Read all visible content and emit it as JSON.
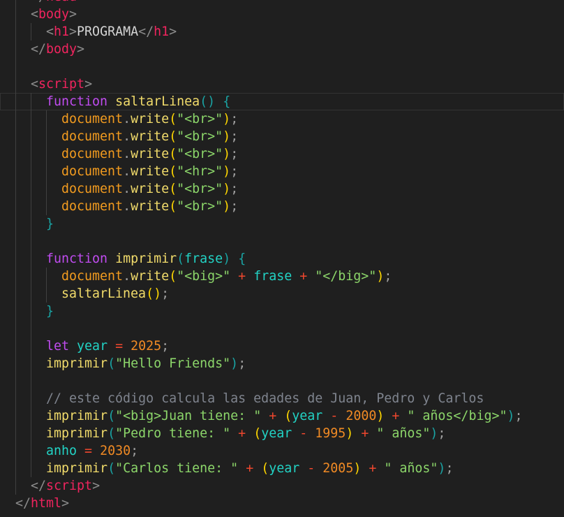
{
  "editor": {
    "current_line": 6,
    "lines": [
      {
        "indent": 1,
        "tokens": [
          [
            "</",
            "b"
          ],
          [
            "head",
            "t"
          ],
          [
            ">",
            "b"
          ]
        ]
      },
      {
        "indent": 1,
        "tokens": [
          [
            "<",
            "b"
          ],
          [
            "body",
            "t"
          ],
          [
            ">",
            "b"
          ]
        ]
      },
      {
        "indent": 2,
        "tokens": [
          [
            "<",
            "b"
          ],
          [
            "h1",
            "t"
          ],
          [
            ">",
            "b"
          ],
          [
            "PROGRAMA",
            "x"
          ],
          [
            "</",
            "b"
          ],
          [
            "h1",
            "t"
          ],
          [
            ">",
            "b"
          ]
        ]
      },
      {
        "indent": 1,
        "tokens": [
          [
            "</",
            "b"
          ],
          [
            "body",
            "t"
          ],
          [
            ">",
            "b"
          ]
        ]
      },
      {
        "indent": 1,
        "tokens": []
      },
      {
        "indent": 1,
        "tokens": [
          [
            "<",
            "b"
          ],
          [
            "script",
            "t"
          ],
          [
            ">",
            "b"
          ]
        ]
      },
      {
        "indent": 2,
        "tokens": [
          [
            "function",
            "k"
          ],
          [
            " ",
            "x"
          ],
          [
            "saltarLinea",
            "f"
          ],
          [
            "()",
            "pt"
          ],
          [
            " ",
            "x"
          ],
          [
            "{",
            "pt"
          ]
        ]
      },
      {
        "indent": 3,
        "tokens": [
          [
            "document",
            "d"
          ],
          [
            ".",
            "p"
          ],
          [
            "write",
            "f"
          ],
          [
            "(",
            "pg"
          ],
          [
            "\"<br>\"",
            "s"
          ],
          [
            ")",
            "pg"
          ],
          [
            ";",
            "p"
          ]
        ]
      },
      {
        "indent": 3,
        "tokens": [
          [
            "document",
            "d"
          ],
          [
            ".",
            "p"
          ],
          [
            "write",
            "f"
          ],
          [
            "(",
            "pg"
          ],
          [
            "\"<br>\"",
            "s"
          ],
          [
            ")",
            "pg"
          ],
          [
            ";",
            "p"
          ]
        ]
      },
      {
        "indent": 3,
        "tokens": [
          [
            "document",
            "d"
          ],
          [
            ".",
            "p"
          ],
          [
            "write",
            "f"
          ],
          [
            "(",
            "pg"
          ],
          [
            "\"<br>\"",
            "s"
          ],
          [
            ")",
            "pg"
          ],
          [
            ";",
            "p"
          ]
        ]
      },
      {
        "indent": 3,
        "tokens": [
          [
            "document",
            "d"
          ],
          [
            ".",
            "p"
          ],
          [
            "write",
            "f"
          ],
          [
            "(",
            "pg"
          ],
          [
            "\"<hr>\"",
            "s"
          ],
          [
            ")",
            "pg"
          ],
          [
            ";",
            "p"
          ]
        ]
      },
      {
        "indent": 3,
        "tokens": [
          [
            "document",
            "d"
          ],
          [
            ".",
            "p"
          ],
          [
            "write",
            "f"
          ],
          [
            "(",
            "pg"
          ],
          [
            "\"<br>\"",
            "s"
          ],
          [
            ")",
            "pg"
          ],
          [
            ";",
            "p"
          ]
        ]
      },
      {
        "indent": 3,
        "tokens": [
          [
            "document",
            "d"
          ],
          [
            ".",
            "p"
          ],
          [
            "write",
            "f"
          ],
          [
            "(",
            "pg"
          ],
          [
            "\"<br>\"",
            "s"
          ],
          [
            ")",
            "pg"
          ],
          [
            ";",
            "p"
          ]
        ]
      },
      {
        "indent": 2,
        "tokens": [
          [
            "}",
            "pt"
          ]
        ]
      },
      {
        "indent": 2,
        "tokens": []
      },
      {
        "indent": 2,
        "tokens": [
          [
            "function",
            "k"
          ],
          [
            " ",
            "x"
          ],
          [
            "imprimir",
            "f"
          ],
          [
            "(",
            "pt"
          ],
          [
            "frase",
            "v"
          ],
          [
            ")",
            "pt"
          ],
          [
            " ",
            "x"
          ],
          [
            "{",
            "pt"
          ]
        ]
      },
      {
        "indent": 3,
        "tokens": [
          [
            "document",
            "d"
          ],
          [
            ".",
            "p"
          ],
          [
            "write",
            "f"
          ],
          [
            "(",
            "pg"
          ],
          [
            "\"<big>\"",
            "s"
          ],
          [
            " + ",
            "o"
          ],
          [
            "frase",
            "v"
          ],
          [
            " + ",
            "o"
          ],
          [
            "\"</big>\"",
            "s"
          ],
          [
            ")",
            "pg"
          ],
          [
            ";",
            "p"
          ]
        ]
      },
      {
        "indent": 3,
        "tokens": [
          [
            "saltarLinea",
            "f"
          ],
          [
            "()",
            "pg"
          ],
          [
            ";",
            "p"
          ]
        ]
      },
      {
        "indent": 2,
        "tokens": [
          [
            "}",
            "pt"
          ]
        ]
      },
      {
        "indent": 2,
        "tokens": []
      },
      {
        "indent": 2,
        "tokens": [
          [
            "let",
            "k"
          ],
          [
            " ",
            "x"
          ],
          [
            "year",
            "v"
          ],
          [
            " = ",
            "o"
          ],
          [
            "2025",
            "n"
          ],
          [
            ";",
            "p"
          ]
        ]
      },
      {
        "indent": 2,
        "tokens": [
          [
            "imprimir",
            "f"
          ],
          [
            "(",
            "pt"
          ],
          [
            "\"Hello Friends\"",
            "s"
          ],
          [
            ")",
            "pt"
          ],
          [
            ";",
            "p"
          ]
        ]
      },
      {
        "indent": 2,
        "tokens": []
      },
      {
        "indent": 2,
        "tokens": [
          [
            "// este código calcula las edades de Juan, Pedro y Carlos",
            "c"
          ]
        ]
      },
      {
        "indent": 2,
        "tokens": [
          [
            "imprimir",
            "f"
          ],
          [
            "(",
            "pt"
          ],
          [
            "\"<big>Juan tiene: \"",
            "s"
          ],
          [
            " + ",
            "o"
          ],
          [
            "(",
            "pg"
          ],
          [
            "year",
            "v"
          ],
          [
            " - ",
            "o"
          ],
          [
            "2000",
            "n"
          ],
          [
            ")",
            "pg"
          ],
          [
            " + ",
            "o"
          ],
          [
            "\" años</big>\"",
            "s"
          ],
          [
            ")",
            "pt"
          ],
          [
            ";",
            "p"
          ]
        ]
      },
      {
        "indent": 2,
        "tokens": [
          [
            "imprimir",
            "f"
          ],
          [
            "(",
            "pt"
          ],
          [
            "\"Pedro tiene: \"",
            "s"
          ],
          [
            " + ",
            "o"
          ],
          [
            "(",
            "pg"
          ],
          [
            "year",
            "v"
          ],
          [
            " - ",
            "o"
          ],
          [
            "1995",
            "n"
          ],
          [
            ")",
            "pg"
          ],
          [
            " + ",
            "o"
          ],
          [
            "\" años\"",
            "s"
          ],
          [
            ")",
            "pt"
          ],
          [
            ";",
            "p"
          ]
        ]
      },
      {
        "indent": 2,
        "tokens": [
          [
            "anho",
            "v"
          ],
          [
            " = ",
            "o"
          ],
          [
            "2030",
            "n"
          ],
          [
            ";",
            "p"
          ]
        ]
      },
      {
        "indent": 2,
        "tokens": [
          [
            "imprimir",
            "f"
          ],
          [
            "(",
            "pt"
          ],
          [
            "\"Carlos tiene: \"",
            "s"
          ],
          [
            " + ",
            "o"
          ],
          [
            "(",
            "pg"
          ],
          [
            "year",
            "v"
          ],
          [
            " - ",
            "o"
          ],
          [
            "2005",
            "n"
          ],
          [
            ")",
            "pg"
          ],
          [
            " + ",
            "o"
          ],
          [
            "\" años\"",
            "s"
          ],
          [
            ")",
            "pt"
          ],
          [
            ";",
            "p"
          ]
        ]
      },
      {
        "indent": 1,
        "tokens": [
          [
            "</",
            "b"
          ],
          [
            "script",
            "t"
          ],
          [
            ">",
            "b"
          ]
        ]
      },
      {
        "indent": 0,
        "tokens": [
          [
            "</",
            "b"
          ],
          [
            "html",
            "t"
          ],
          [
            ">",
            "b"
          ]
        ]
      }
    ]
  }
}
